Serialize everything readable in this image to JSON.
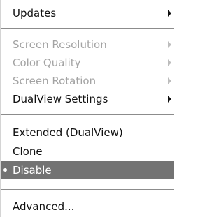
{
  "menu": {
    "updates": "Updates",
    "screen_resolution": "Screen Resolution",
    "color_quality": "Color Quality",
    "screen_rotation": "Screen Rotation",
    "dualview_settings": "DualView Settings",
    "extended": "Extended (DualView)",
    "clone": "Clone",
    "disable": "Disable",
    "advanced": "Advanced...",
    "selected_item": "Disable"
  },
  "icons": {
    "submenu_arrow": "submenu-arrow-icon",
    "selected_bullet": "radio-bullet-icon"
  },
  "colors": {
    "highlight": "#737373",
    "disabled_text": "#a3a3a3",
    "separator": "#8c8c8c"
  }
}
